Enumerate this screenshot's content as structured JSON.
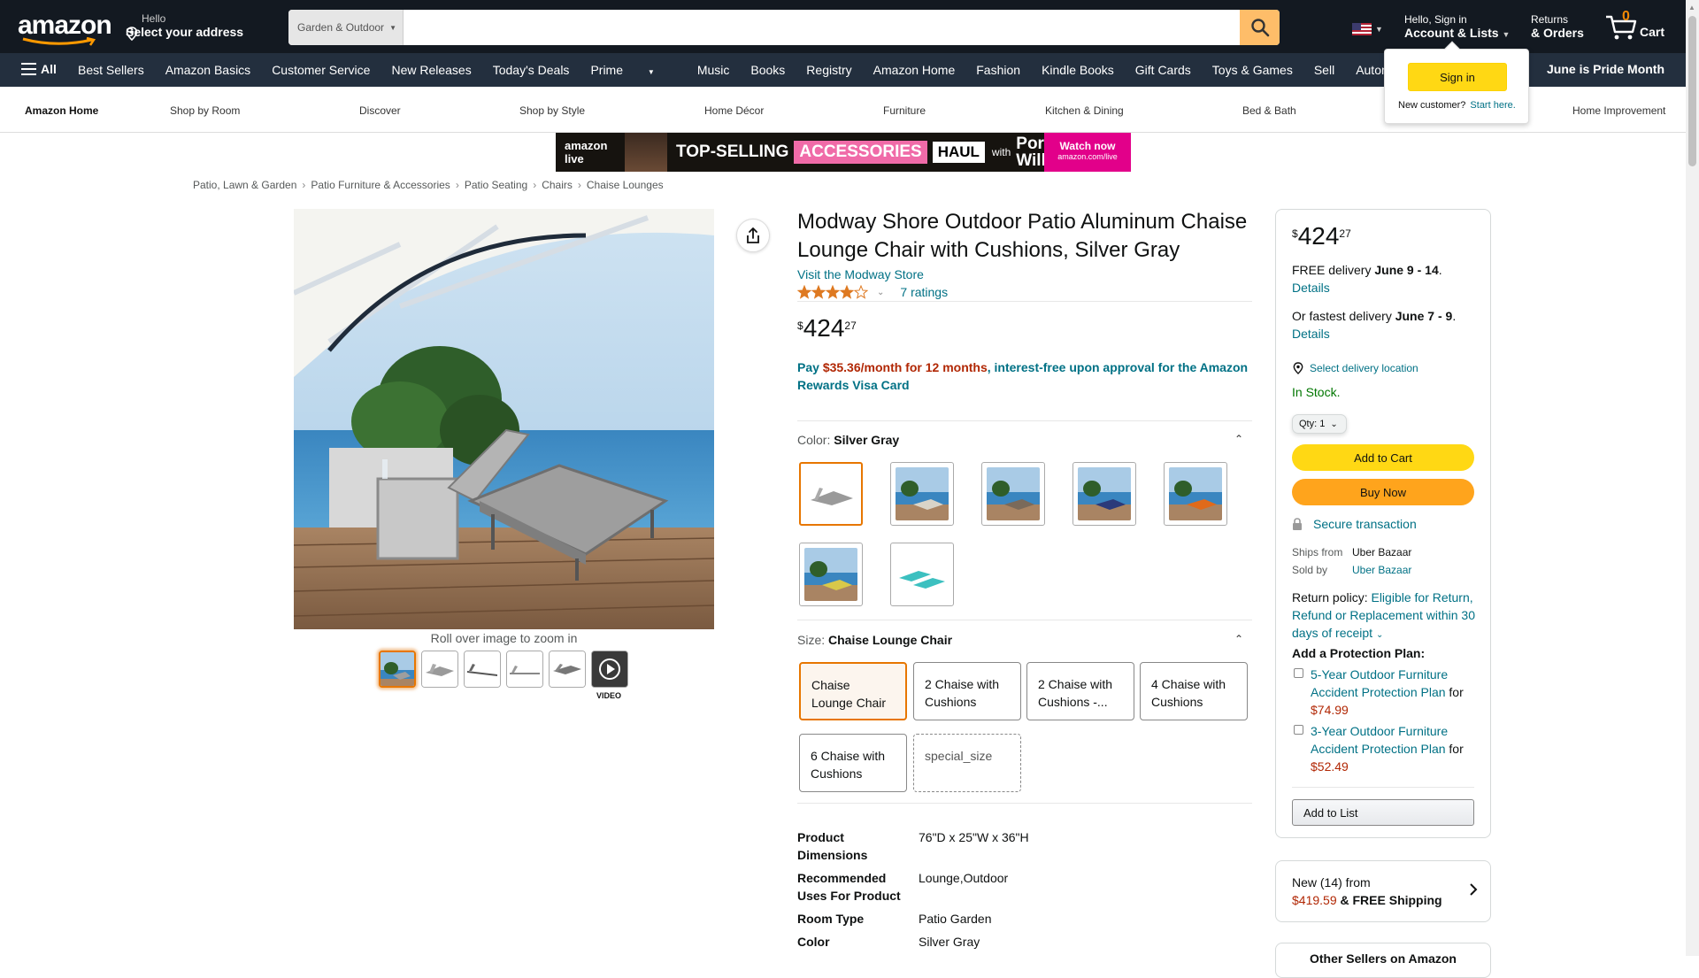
{
  "topnav": {
    "logo_text": "amazon",
    "deliver_line1": "Hello",
    "deliver_line2": "Select your address",
    "search_category": "Garden & Outdoor",
    "search_placeholder": "",
    "account_line1": "Hello, Sign in",
    "account_line2": "Account & Lists",
    "returns_line1": "Returns",
    "returns_line2": "& Orders",
    "cart_count": "0",
    "cart_label": "Cart"
  },
  "subnav": {
    "all_label": "All",
    "items": [
      "Best Sellers",
      "Amazon Basics",
      "Customer Service",
      "New Releases",
      "Today's Deals",
      "Prime",
      "Music",
      "Books",
      "Registry",
      "Amazon Home",
      "Fashion",
      "Kindle Books",
      "Gift Cards",
      "Toys & Games",
      "Sell",
      "Automotive"
    ],
    "promo": "June is Pride Month"
  },
  "flyout": {
    "signin_label": "Sign in",
    "new_customer": "New customer?",
    "start_here": "Start here."
  },
  "storenav": {
    "items": [
      "Amazon Home",
      "Shop by Room",
      "Discover",
      "Shop by Style",
      "Home Décor",
      "Furniture",
      "Kitchen & Dining",
      "Bed & Bath",
      "Home Improvement"
    ]
  },
  "banner": {
    "live": "amazon live",
    "top": "TOP-SELLING",
    "accessories": "ACCESSORIES",
    "haul": "HAUL",
    "with": "with",
    "name": "Porsha Williams",
    "watch": "Watch now",
    "watch_url": "amazon.com/live"
  },
  "breadcrumb": [
    "Patio, Lawn & Garden",
    "Patio Furniture & Accessories",
    "Patio Seating",
    "Chairs",
    "Chaise Lounges"
  ],
  "gallery": {
    "zoom_hint": "Roll over image to zoom in",
    "video_label": "VIDEO",
    "thumb_count": 6,
    "active_index": 0
  },
  "product": {
    "title": "Modway Shore Outdoor Patio Aluminum Chaise Lounge Chair with Cushions, Silver Gray",
    "store_link": "Visit the Modway Store",
    "rating": 4.0,
    "ratings_count": "7 ratings",
    "price_symbol": "$",
    "price_whole": "424",
    "price_fraction": "27",
    "financing_pay": "Pay",
    "financing_amount": "$35.36/month for 12 months",
    "financing_rest": ", interest-free upon approval for the Amazon Rewards Visa Card",
    "color_label": "Color:",
    "color_value": "Silver Gray",
    "swatch_colors": [
      "#9a9a9a",
      "#d9d4c8",
      "#7a6a5a",
      "#2b3a7a",
      "#e06a1a",
      "#d8c84a",
      "#3cc0c0"
    ],
    "size_label": "Size:",
    "size_value": "Chaise Lounge Chair",
    "sizes": [
      "Chaise Lounge Chair",
      "2 Chaise with Cushions",
      "2 Chaise with Cushions -...",
      "4 Chaise with Cushions",
      "6 Chaise with Cushions",
      "special_size"
    ],
    "specs": [
      {
        "k": "Product Dimensions",
        "v": "76\"D x 25\"W x 36\"H"
      },
      {
        "k": "Recommended Uses For Product",
        "v": "Lounge,Outdoor"
      },
      {
        "k": "Room Type",
        "v": "Patio Garden"
      },
      {
        "k": "Color",
        "v": "Silver Gray"
      }
    ]
  },
  "buybox": {
    "price_symbol": "$",
    "price_whole": "424",
    "price_fraction": "27",
    "free_delivery": "FREE delivery",
    "free_dates": "June 9 - 14",
    "details": "Details",
    "fastest": "Or fastest delivery",
    "fastest_dates": "June 7 - 9",
    "select_location": "Select delivery location",
    "stock": "In Stock.",
    "qty_label": "Qty:",
    "qty_value": "1",
    "add_to_cart": "Add to Cart",
    "buy_now": "Buy Now",
    "secure": "Secure transaction",
    "ships_from_k": "Ships from",
    "ships_from_v": "Uber Bazaar",
    "sold_by_k": "Sold by",
    "sold_by_v": "Uber Bazaar",
    "return_label": "Return policy:",
    "return_link": "Eligible for Return, Refund or Replacement within 30 days of receipt",
    "protection_title": "Add a Protection Plan:",
    "plan1_link": "5-Year Outdoor Furniture Accident Protection Plan",
    "plan1_for": "for",
    "plan1_price": "$74.99",
    "plan2_link": "3-Year Outdoor Furniture Accident Protection Plan",
    "plan2_for": "for",
    "plan2_price": "$52.49",
    "add_to_list": "Add to List"
  },
  "newbox": {
    "line1": "New (14) from",
    "price": "$419.59",
    "shipping": "& FREE Shipping"
  },
  "otherbox": {
    "line1": "Other Sellers on Amazon"
  },
  "colors": {
    "nav_dark": "#131921",
    "nav_secondary": "#232f3e",
    "link": "#007185",
    "price_red": "#b12704",
    "cart_yellow": "#ffd814",
    "buy_orange": "#ffa41c",
    "selected_outline": "#e77600",
    "star": "#de7921",
    "stock_green": "#007600"
  }
}
